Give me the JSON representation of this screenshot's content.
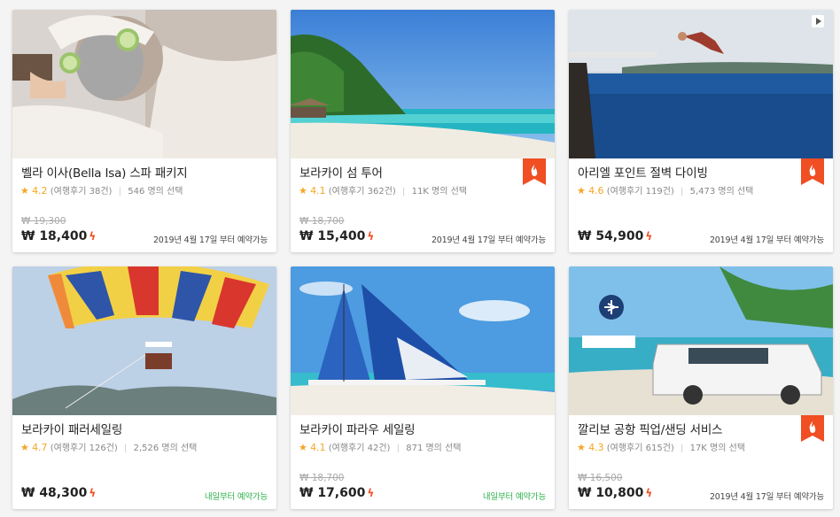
{
  "cards": [
    {
      "title": "벨라 이사(Bella Isa) 스파 패키지",
      "star": "★",
      "rating": "4.2",
      "reviews": "(여행후기 38건)",
      "sep": "|",
      "chosen": "546 명의 선택",
      "old_price": "₩ 19,300",
      "price": "₩ 18,400",
      "bolt": "ϟ",
      "availability": "2019년 4월 17일 부터 예약가능",
      "hot": false,
      "video": false
    },
    {
      "title": "보라카이 섬 투어",
      "star": "★",
      "rating": "4.1",
      "reviews": "(여행후기 362건)",
      "sep": "|",
      "chosen": "11K 명의 선택",
      "old_price": "₩ 18,700",
      "price": "₩ 15,400",
      "bolt": "ϟ",
      "availability": "2019년 4월 17일 부터 예약가능",
      "hot": true,
      "video": false
    },
    {
      "title": "아리엘 포인트 절벽 다이빙",
      "star": "★",
      "rating": "4.6",
      "reviews": "(여행후기 119건)",
      "sep": "|",
      "chosen": "5,473 명의 선택",
      "old_price": "",
      "price": "₩ 54,900",
      "bolt": "ϟ",
      "availability": "2019년 4월 17일 부터 예약가능",
      "hot": true,
      "video": true
    },
    {
      "title": "보라카이 패러세일링",
      "star": "★",
      "rating": "4.7",
      "reviews": "(여행후기 126건)",
      "sep": "|",
      "chosen": "2,526 명의 선택",
      "old_price": "",
      "price": "₩ 48,300",
      "bolt": "ϟ",
      "availability": "내일부터 예약가능",
      "hot": false,
      "video": false
    },
    {
      "title": "보라카이 파라우 세일링",
      "star": "★",
      "rating": "4.1",
      "reviews": "(여행후기 42건)",
      "sep": "|",
      "chosen": "871 명의 선택",
      "old_price": "₩ 18,700",
      "price": "₩ 17,600",
      "bolt": "ϟ",
      "availability": "내일부터 예약가능",
      "hot": false,
      "video": false
    },
    {
      "title": "깔리보 공항 픽업/샌딩 서비스",
      "star": "★",
      "rating": "4.3",
      "reviews": "(여행후기 615건)",
      "sep": "|",
      "chosen": "17K 명의 선택",
      "old_price": "₩ 16,500",
      "price": "₩ 10,800",
      "bolt": "ϟ",
      "availability": "2019년 4월 17일 부터 예약가능",
      "hot": true,
      "video": false
    }
  ],
  "colors": {
    "accent": "#f04e23",
    "star": "#f5a623",
    "available_green": "#2db14b"
  }
}
